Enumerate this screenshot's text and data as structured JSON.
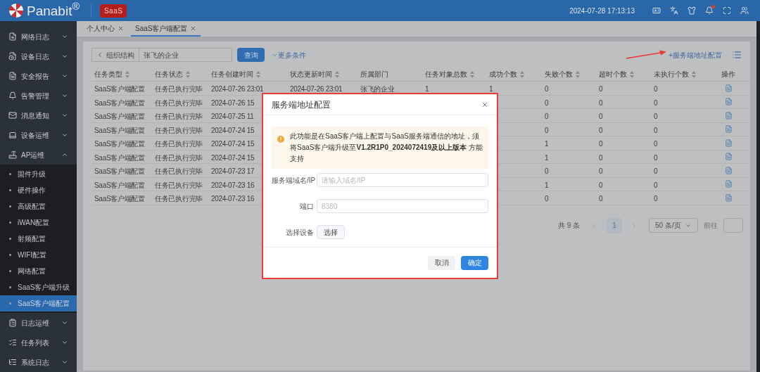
{
  "header": {
    "brand": "Panabit$^{®}$",
    "badge": "SaaS",
    "datetime": "2024-07-28 17:13:13",
    "has_notification": true
  },
  "sidebar": {
    "items": [
      {
        "label": "网络日志",
        "expanded": false
      },
      {
        "label": "设备日志",
        "expanded": false
      },
      {
        "label": "安全报告",
        "expanded": false
      },
      {
        "label": "告警管理",
        "expanded": false
      },
      {
        "label": "消息通知",
        "expanded": false
      },
      {
        "label": "设备运维",
        "expanded": false
      },
      {
        "label": "AP运维",
        "expanded": true,
        "children": [
          {
            "label": "固件升级",
            "selected": false
          },
          {
            "label": "硬件操作",
            "selected": false
          },
          {
            "label": "高级配置",
            "selected": false
          },
          {
            "label": "iWAN配置",
            "selected": false
          },
          {
            "label": "射频配置",
            "selected": false
          },
          {
            "label": "WIFI配置",
            "selected": false
          },
          {
            "label": "网络配置",
            "selected": false
          },
          {
            "label": "SaaS客户端升级",
            "selected": false
          },
          {
            "label": "SaaS客户端配置",
            "selected": true
          }
        ]
      },
      {
        "label": "日志运维",
        "expanded": false
      },
      {
        "label": "任务列表",
        "expanded": false
      },
      {
        "label": "系统日志",
        "expanded": false
      }
    ]
  },
  "tabs": [
    {
      "label": "个人中心",
      "selected": false
    },
    {
      "label": "SaaS客户端配置",
      "selected": true
    }
  ],
  "filter": {
    "back_label": "组织结构",
    "org_value": "张飞的企业",
    "query_button": "查询",
    "more_link": "更多条件",
    "add_link": "+服务端地址配置"
  },
  "table": {
    "columns": [
      {
        "label": "任务类型",
        "sortable": true
      },
      {
        "label": "任务状态",
        "sortable": true
      },
      {
        "label": "任务创建时间",
        "sortable": true
      },
      {
        "label": "状态更新时间",
        "sortable": true
      },
      {
        "label": "所属部门",
        "sortable": false
      },
      {
        "label": "任务对象总数",
        "sortable": true
      },
      {
        "label": "成功个数",
        "sortable": true
      },
      {
        "label": "失败个数",
        "sortable": true
      },
      {
        "label": "超时个数",
        "sortable": true
      },
      {
        "label": "未执行个数",
        "sortable": true
      },
      {
        "label": "操作",
        "sortable": false
      }
    ],
    "rows": [
      {
        "type": "SaaS客户端配置",
        "status": "任务已执行完毕",
        "created": "2024-07-26 23:01",
        "updated": "2024-07-26 23:01",
        "department": "张飞的企业",
        "total": "1",
        "success": "1",
        "failed": "0",
        "timeout": "0",
        "pending": "0"
      },
      {
        "type": "SaaS客户端配置",
        "status": "任务已执行完毕",
        "created": "2024-07-26 15",
        "failed": "0",
        "timeout": "0",
        "pending": "0"
      },
      {
        "type": "SaaS客户端配置",
        "status": "任务已执行完毕",
        "created": "2024-07-25 11",
        "failed": "0",
        "timeout": "0",
        "pending": "0"
      },
      {
        "type": "SaaS客户端配置",
        "status": "任务已执行完毕",
        "created": "2024-07-24 15",
        "failed": "0",
        "timeout": "0",
        "pending": "0"
      },
      {
        "type": "SaaS客户端配置",
        "status": "任务已执行完毕",
        "created": "2024-07-24 15",
        "failed": "1",
        "timeout": "0",
        "pending": "0"
      },
      {
        "type": "SaaS客户端配置",
        "status": "任务已执行完毕",
        "created": "2024-07-24 15",
        "failed": "1",
        "timeout": "0",
        "pending": "0"
      },
      {
        "type": "SaaS客户端配置",
        "status": "任务已执行完毕",
        "created": "2024-07-23 17",
        "failed": "0",
        "timeout": "0",
        "pending": "0"
      },
      {
        "type": "SaaS客户端配置",
        "status": "任务已执行完毕",
        "created": "2024-07-23 16",
        "failed": "1",
        "timeout": "0",
        "pending": "0"
      },
      {
        "type": "SaaS客户端配置",
        "status": "任务已执行完毕",
        "created": "2024-07-23 16",
        "failed": "0",
        "timeout": "0",
        "pending": "0"
      }
    ]
  },
  "pagination": {
    "total": "共 9 条",
    "pages": [
      {
        "label": "1",
        "selected": true
      }
    ],
    "page_size": "50 条/页",
    "goto_label": "前往"
  },
  "dialog": {
    "title": "服务端地址配置",
    "notice": "此功能是在SaaS客户端上配置与SaaS服务端通信的地址，须将SaaS客户端升级至**V1.2R1P0_2024072419及以上版本** 方能支持",
    "fields": [
      {
        "label": "服务端域名/IP",
        "placeholder": "请输入域名/IP"
      },
      {
        "label": "端口",
        "placeholder": "8380"
      }
    ],
    "device_label": "选择设备",
    "device_button": "选择",
    "buttons": [
      {
        "label": "取消",
        "kind": "secondary"
      },
      {
        "label": "确定",
        "kind": "primary"
      }
    ]
  }
}
